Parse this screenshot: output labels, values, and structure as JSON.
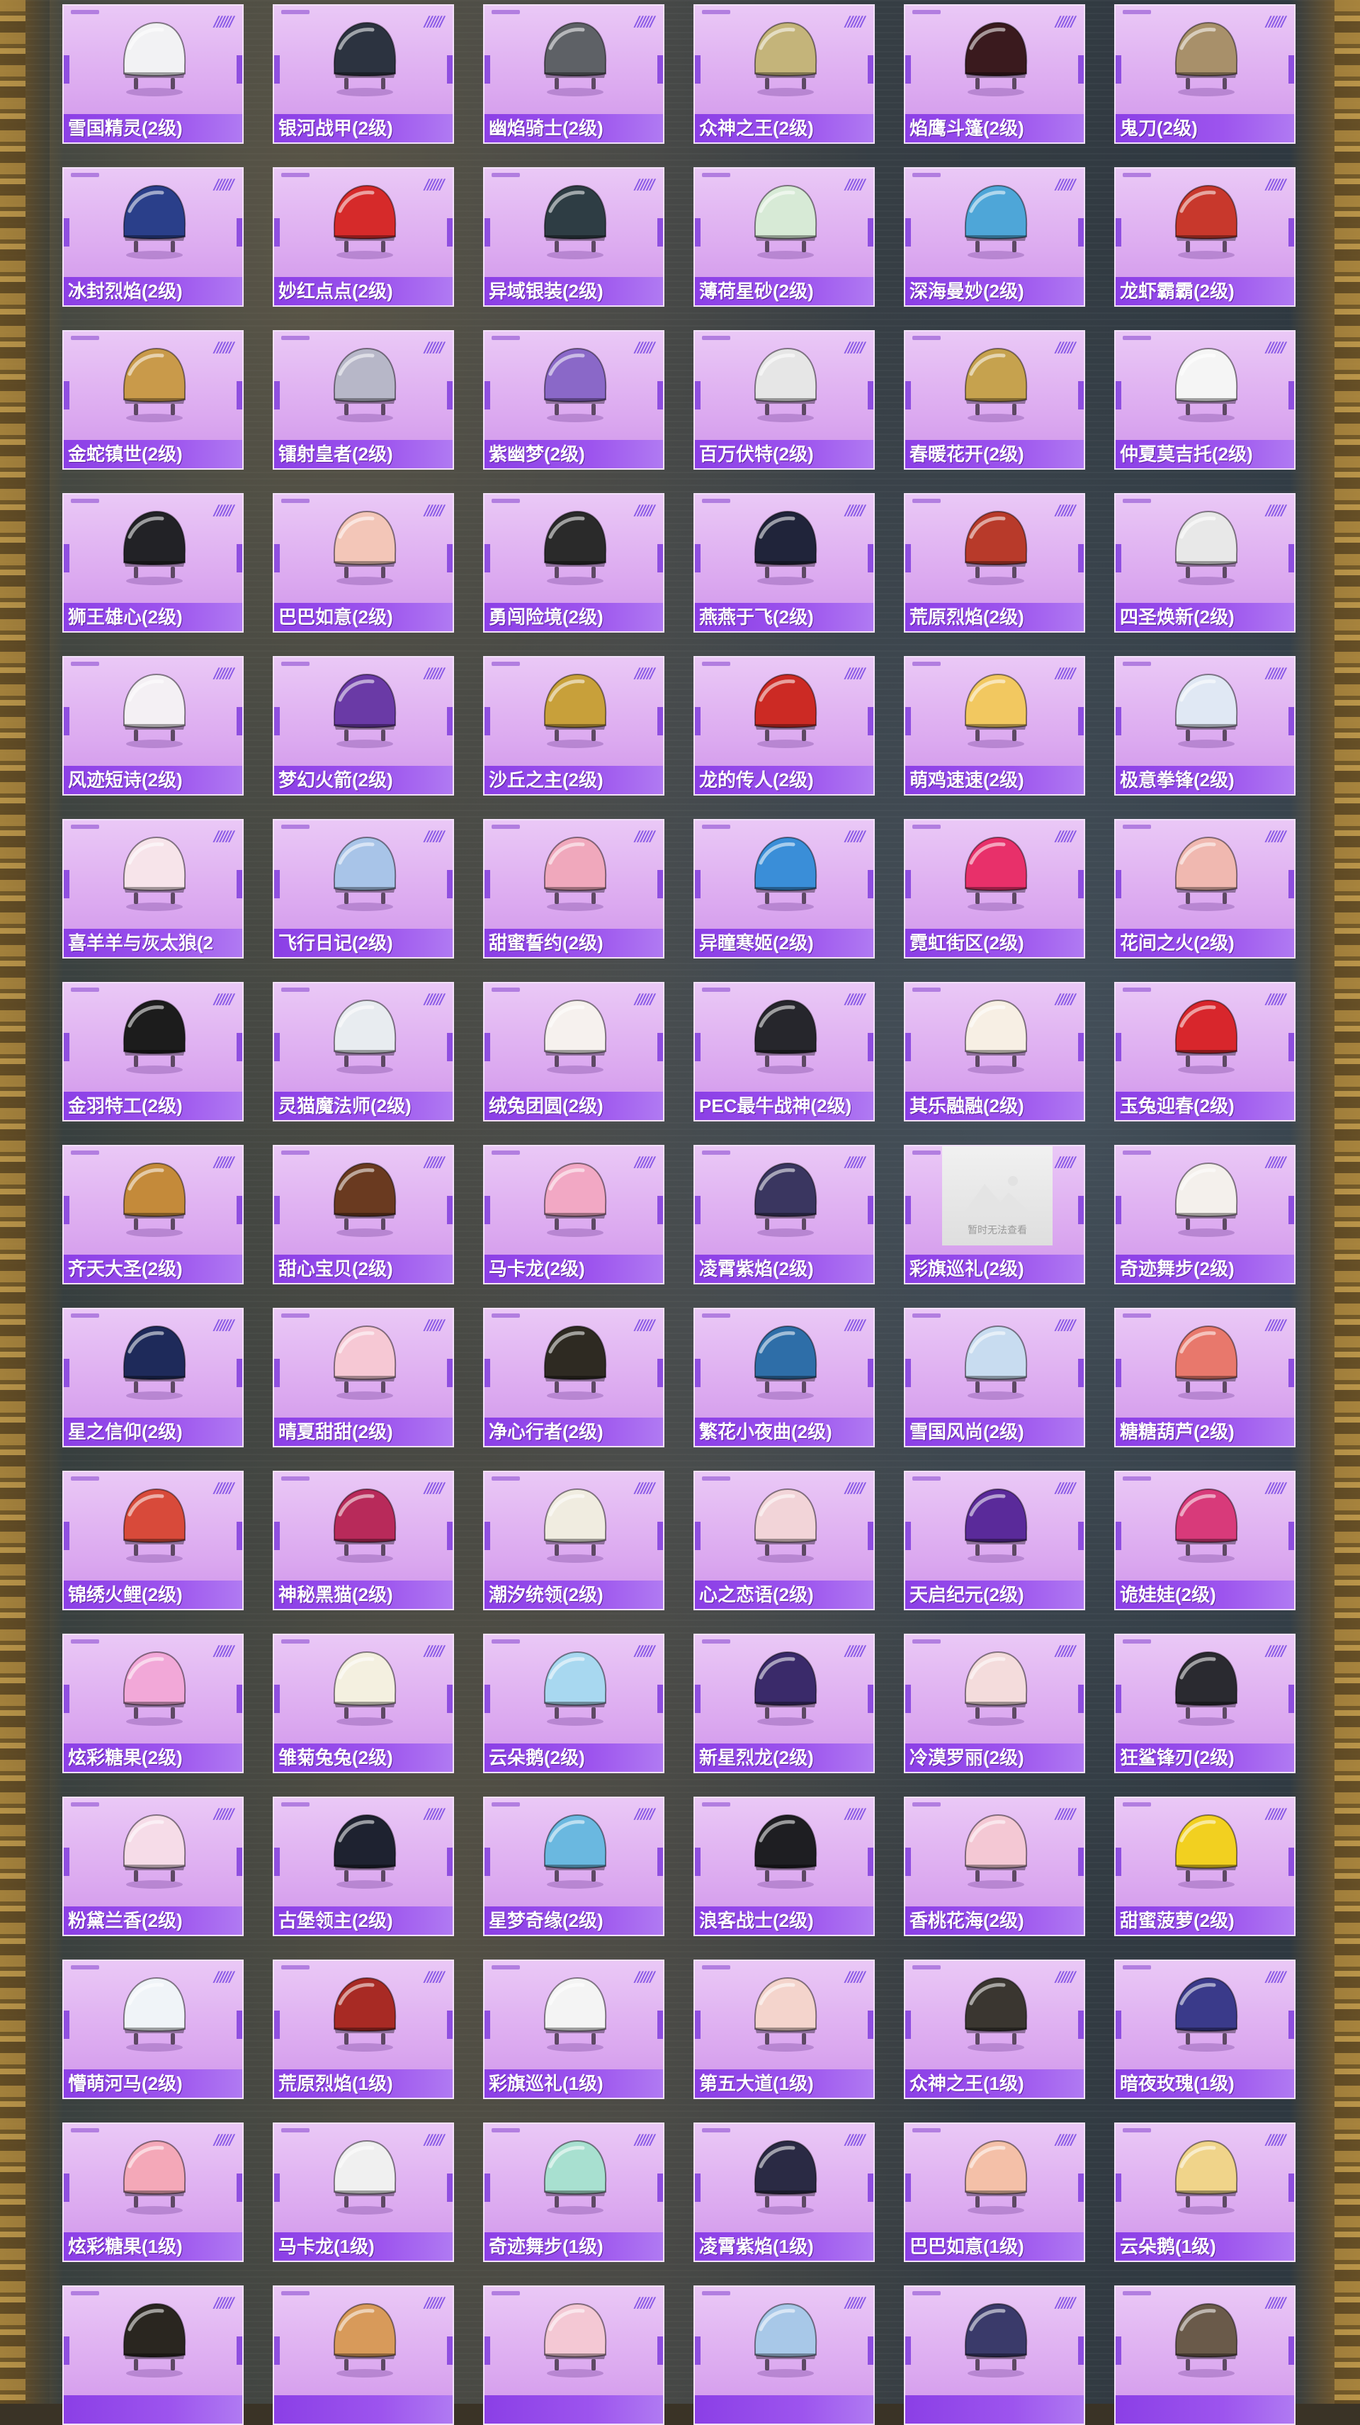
{
  "page": {
    "placeholder_text": "暂时无法查看"
  },
  "items": [
    {
      "name": "雪国精灵(2级)",
      "color": "#f2f2f4"
    },
    {
      "name": "银河战甲(2级)",
      "color": "#2c3340"
    },
    {
      "name": "幽焰骑士(2级)",
      "color": "#5e6166"
    },
    {
      "name": "众神之王(2级)",
      "color": "#c4b47a"
    },
    {
      "name": "焰鹰斗篷(2级)",
      "color": "#3a1a1e"
    },
    {
      "name": "鬼刀(2级)",
      "color": "#a8906a"
    },
    {
      "name": "冰封烈焰(2级)",
      "color": "#2a3f8a"
    },
    {
      "name": "妙红点点(2级)",
      "color": "#d62a2a"
    },
    {
      "name": "异域银装(2级)",
      "color": "#2e3d44"
    },
    {
      "name": "薄荷星砂(2级)",
      "color": "#d7ead6"
    },
    {
      "name": "深海曼妙(2级)",
      "color": "#4ea6d8"
    },
    {
      "name": "龙虾霸霸(2级)",
      "color": "#c8382c"
    },
    {
      "name": "金蛇镇世(2级)",
      "color": "#c99a4a"
    },
    {
      "name": "镭射皇者(2级)",
      "color": "#b7b7c8"
    },
    {
      "name": "紫幽梦(2级)",
      "color": "#8a68c8"
    },
    {
      "name": "百万伏特(2级)",
      "color": "#e6e6e6"
    },
    {
      "name": "春暖花开(2级)",
      "color": "#c6a24e"
    },
    {
      "name": "仲夏莫吉托(2级)",
      "color": "#f5f5f5"
    },
    {
      "name": "狮王雄心(2级)",
      "color": "#222226"
    },
    {
      "name": "巴巴如意(2级)",
      "color": "#f3c6b8"
    },
    {
      "name": "勇闯险境(2级)",
      "color": "#2a2a2a"
    },
    {
      "name": "燕燕于飞(2级)",
      "color": "#20243a"
    },
    {
      "name": "荒原烈焰(2级)",
      "color": "#b83a2a"
    },
    {
      "name": "四圣焕新(2级)",
      "color": "#e8e8e8"
    },
    {
      "name": "风迹短诗(2级)",
      "color": "#f4f0f4"
    },
    {
      "name": "梦幻火箭(2级)",
      "color": "#6a3aa6"
    },
    {
      "name": "沙丘之主(2级)",
      "color": "#c8a03a"
    },
    {
      "name": "龙的传人(2级)",
      "color": "#cc2a24"
    },
    {
      "name": "萌鸡速速(2级)",
      "color": "#f2c860"
    },
    {
      "name": "极意拳锋(2级)",
      "color": "#e0e8f4"
    },
    {
      "name": "喜羊羊与灰太狼(2",
      "color": "#f7e4ea"
    },
    {
      "name": "飞行日记(2级)",
      "color": "#a8c4e8"
    },
    {
      "name": "甜蜜誓约(2级)",
      "color": "#f0a8bc"
    },
    {
      "name": "异瞳寒姬(2级)",
      "color": "#3a8ed8"
    },
    {
      "name": "霓虹街区(2级)",
      "color": "#e8306a"
    },
    {
      "name": "花间之火(2级)",
      "color": "#f0b8b0"
    },
    {
      "name": "金羽特工(2级)",
      "color": "#1c1c1c"
    },
    {
      "name": "灵猫魔法师(2级)",
      "color": "#e8ecf0"
    },
    {
      "name": "绒兔团圆(2级)",
      "color": "#f6f1ee"
    },
    {
      "name": "PEC最牛战神(2级)",
      "color": "#26262c"
    },
    {
      "name": "其乐融融(2级)",
      "color": "#f7efe4"
    },
    {
      "name": "玉兔迎春(2级)",
      "color": "#d8262c"
    },
    {
      "name": "齐天大圣(2级)",
      "color": "#c48a3a"
    },
    {
      "name": "甜心宝贝(2级)",
      "color": "#6a3a20"
    },
    {
      "name": "马卡龙(2级)",
      "color": "#f2a8c4"
    },
    {
      "name": "凌霄紫焰(2级)",
      "color": "#3a3660"
    },
    {
      "name": "彩旗巡礼(2级)",
      "color": "#e8e8e8",
      "placeholder": true
    },
    {
      "name": "奇迹舞步(2级)",
      "color": "#f4f0ec"
    },
    {
      "name": "星之信仰(2级)",
      "color": "#1e2a5a"
    },
    {
      "name": "晴夏甜甜(2级)",
      "color": "#f6c8d4"
    },
    {
      "name": "净心行者(2级)",
      "color": "#2e2a22"
    },
    {
      "name": "繁花小夜曲(2级)",
      "color": "#2e6ea8"
    },
    {
      "name": "雪国风尚(2级)",
      "color": "#c8dcf0"
    },
    {
      "name": "糖糖葫芦(2级)",
      "color": "#e8786c"
    },
    {
      "name": "锦绣火鲤(2级)",
      "color": "#d84a3a"
    },
    {
      "name": "神秘黑猫(2级)",
      "color": "#b82a5a"
    },
    {
      "name": "潮汐统领(2级)",
      "color": "#f0ece0"
    },
    {
      "name": "心之恋语(2级)",
      "color": "#f2d4d8"
    },
    {
      "name": "天启纪元(2级)",
      "color": "#5a2a9a"
    },
    {
      "name": "诡娃娃(2级)",
      "color": "#d83a7a"
    },
    {
      "name": "炫彩糖果(2级)",
      "color": "#f2a8d8"
    },
    {
      "name": "雏菊兔兔(2级)",
      "color": "#f4f0e0"
    },
    {
      "name": "云朵鹅(2级)",
      "color": "#a8d8f0"
    },
    {
      "name": "新星烈龙(2级)",
      "color": "#3a2a6a"
    },
    {
      "name": "冷漠罗丽(2级)",
      "color": "#f4dcdc"
    },
    {
      "name": "狂鲨锋刃(2级)",
      "color": "#2a2a30"
    },
    {
      "name": "粉黛兰香(2级)",
      "color": "#f6dce8"
    },
    {
      "name": "古堡领主(2级)",
      "color": "#1e2230"
    },
    {
      "name": "星梦奇缘(2级)",
      "color": "#6ab8e0"
    },
    {
      "name": "浪客战士(2级)",
      "color": "#1e1e22"
    },
    {
      "name": "香桃花海(2级)",
      "color": "#f4c8d4"
    },
    {
      "name": "甜蜜菠萝(2级)",
      "color": "#f2d020"
    },
    {
      "name": "懵萌河马(2级)",
      "color": "#f0f4f8"
    },
    {
      "name": "荒原烈焰(1级)",
      "color": "#a82a24"
    },
    {
      "name": "彩旗巡礼(1级)",
      "color": "#f4f4f4"
    },
    {
      "name": "第五大道(1级)",
      "color": "#f4d4cc"
    },
    {
      "name": "众神之王(1级)",
      "color": "#3a3630"
    },
    {
      "name": "暗夜玫瑰(1级)",
      "color": "#3a3a8a"
    },
    {
      "name": "炫彩糖果(1级)",
      "color": "#f4a8b8"
    },
    {
      "name": "马卡龙(1级)",
      "color": "#f0f0f0"
    },
    {
      "name": "奇迹舞步(1级)",
      "color": "#a8e0d0"
    },
    {
      "name": "凌霄紫焰(1级)",
      "color": "#2a2a44"
    },
    {
      "name": "巴巴如意(1级)",
      "color": "#f4c0a8"
    },
    {
      "name": "云朵鹅(1级)",
      "color": "#f0d48a"
    },
    {
      "name": "",
      "color": "#2a2620"
    },
    {
      "name": "",
      "color": "#d89a5a"
    },
    {
      "name": "",
      "color": "#f4c8d4"
    },
    {
      "name": "",
      "color": "#a8c8e8"
    },
    {
      "name": "",
      "color": "#3a3a6a"
    },
    {
      "name": "",
      "color": "#6a5a4a"
    }
  ]
}
